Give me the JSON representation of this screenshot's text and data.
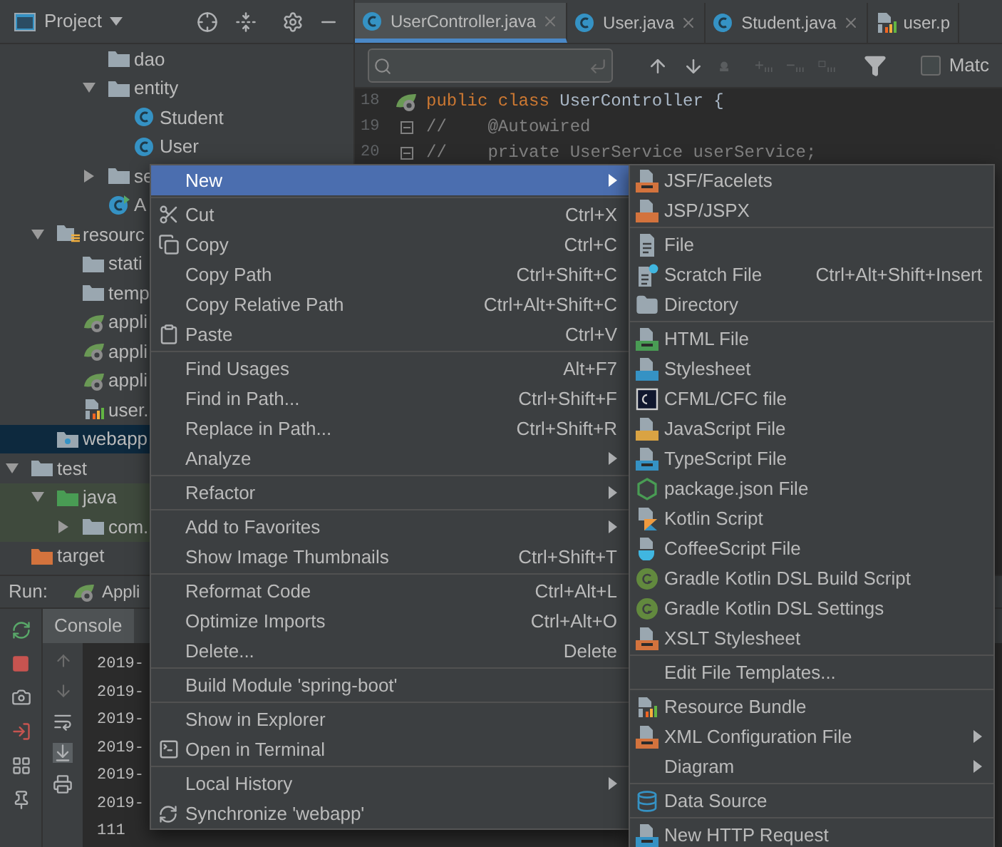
{
  "project_panel": {
    "title": "Project",
    "tree": [
      {
        "children": [
          {
            "children": [
              {
                "children": [
                  {
                    "label": "dao",
                    "kind": "folder",
                    "selected": false
                  },
                  {
                    "label": "entity",
                    "kind": "folder",
                    "expanded": true,
                    "selected": false,
                    "children": [
                      {
                        "label": "Student",
                        "kind": "class",
                        "selected": false
                      },
                      {
                        "label": "User",
                        "kind": "class",
                        "selected": false
                      }
                    ]
                  },
                  {
                    "label": "se",
                    "kind": "folder",
                    "expanded": false,
                    "selected": false
                  },
                  {
                    "label": "A",
                    "kind": "app-class",
                    "selected": false
                  }
                ]
              }
            ]
          },
          {
            "label": "resourc",
            "kind": "resources-folder",
            "expanded": true,
            "selected": false,
            "children": [
              {
                "label": "stati",
                "kind": "folder",
                "selected": false
              },
              {
                "label": "temp",
                "kind": "folder",
                "selected": false
              },
              {
                "label": "appli",
                "kind": "spring",
                "selected": false
              },
              {
                "label": "appli",
                "kind": "spring",
                "selected": false
              },
              {
                "label": "appli",
                "kind": "spring",
                "selected": false
              },
              {
                "label": "user.",
                "kind": "properties",
                "selected": false
              }
            ]
          },
          {
            "label": "webapp",
            "kind": "web-folder",
            "selected": true
          }
        ]
      },
      {
        "label": "test",
        "kind": "folder",
        "expanded": true,
        "selected": false,
        "children": [
          {
            "label": "java",
            "kind": "test-folder",
            "expanded": true,
            "selected": false,
            "children": [
              {
                "label": "com.",
                "kind": "folder",
                "expanded": false,
                "selected": false
              }
            ]
          }
        ]
      },
      {
        "label": "target",
        "kind": "excluded-folder",
        "selected": false
      }
    ]
  },
  "editor": {
    "tabs": [
      {
        "label": "UserController.java",
        "kind": "class",
        "selected": true
      },
      {
        "label": "User.java",
        "kind": "class",
        "selected": false
      },
      {
        "label": "Student.java",
        "kind": "class",
        "selected": false
      },
      {
        "label": "user.p",
        "kind": "properties",
        "selected": false
      }
    ],
    "match_case": {
      "label": "Matc",
      "checked": false
    },
    "lines": [
      {
        "number": "18",
        "segments": [
          {
            "text": "public class ",
            "kind": "keyword"
          },
          {
            "text": "UserController {",
            "kind": "plain"
          }
        ]
      },
      {
        "number": "19",
        "segments": [
          {
            "text": "//    @Autowired",
            "kind": "comment"
          }
        ]
      },
      {
        "number": "20",
        "segments": [
          {
            "text": "//    private UserService userService;",
            "kind": "comment"
          }
        ]
      }
    ]
  },
  "run_panel": {
    "label": "Run:",
    "config": "Appli",
    "tabs": [
      {
        "label": "Console",
        "selected": true
      }
    ],
    "output": [
      "2019-",
      "2019-",
      "2019-",
      "2019-",
      "2019-",
      "2019-",
      "111"
    ]
  },
  "context_menu": {
    "groups": [
      [
        {
          "label": "New",
          "has_submenu": true,
          "selected": true
        }
      ],
      [
        {
          "label": "Cut",
          "shortcut": "Ctrl+X",
          "selected": false
        },
        {
          "label": "Copy",
          "shortcut": "Ctrl+C",
          "selected": false
        },
        {
          "label": "Copy Path",
          "shortcut": "Ctrl+Shift+C",
          "selected": false
        },
        {
          "label": "Copy Relative Path",
          "shortcut": "Ctrl+Alt+Shift+C",
          "selected": false
        },
        {
          "label": "Paste",
          "shortcut": "Ctrl+V",
          "selected": false
        }
      ],
      [
        {
          "label": "Find Usages",
          "shortcut": "Alt+F7",
          "selected": false
        },
        {
          "label": "Find in Path...",
          "shortcut": "Ctrl+Shift+F",
          "selected": false
        },
        {
          "label": "Replace in Path...",
          "shortcut": "Ctrl+Shift+R",
          "selected": false
        },
        {
          "label": "Analyze",
          "has_submenu": true,
          "selected": false
        }
      ],
      [
        {
          "label": "Refactor",
          "has_submenu": true,
          "selected": false
        }
      ],
      [
        {
          "label": "Add to Favorites",
          "has_submenu": true,
          "selected": false
        },
        {
          "label": "Show Image Thumbnails",
          "shortcut": "Ctrl+Shift+T",
          "selected": false
        }
      ],
      [
        {
          "label": "Reformat Code",
          "shortcut": "Ctrl+Alt+L",
          "selected": false
        },
        {
          "label": "Optimize Imports",
          "shortcut": "Ctrl+Alt+O",
          "selected": false
        },
        {
          "label": "Delete...",
          "shortcut": "Delete",
          "selected": false
        }
      ],
      [
        {
          "label": "Build Module 'spring-boot'",
          "selected": false
        }
      ],
      [
        {
          "label": "Show in Explorer",
          "selected": false
        },
        {
          "label": "Open in Terminal",
          "selected": false
        }
      ],
      [
        {
          "label": "Local History",
          "has_submenu": true,
          "selected": false
        },
        {
          "label": "Synchronize 'webapp'",
          "selected": false
        }
      ]
    ]
  },
  "submenu": {
    "groups": [
      [
        {
          "label": "JSF/Facelets",
          "selected": false
        },
        {
          "label": "JSP/JSPX",
          "selected": false
        }
      ],
      [
        {
          "label": "File",
          "selected": false
        },
        {
          "label": "Scratch File",
          "shortcut": "Ctrl+Alt+Shift+Insert",
          "selected": false
        },
        {
          "label": "Directory",
          "selected": false
        }
      ],
      [
        {
          "label": "HTML File",
          "selected": false
        },
        {
          "label": "Stylesheet",
          "selected": false
        },
        {
          "label": "CFML/CFC file",
          "selected": false
        },
        {
          "label": "JavaScript File",
          "selected": false
        },
        {
          "label": "TypeScript File",
          "selected": false
        },
        {
          "label": "package.json File",
          "selected": false
        },
        {
          "label": "Kotlin Script",
          "selected": false
        },
        {
          "label": "CoffeeScript File",
          "selected": false
        },
        {
          "label": "Gradle Kotlin DSL Build Script",
          "selected": false
        },
        {
          "label": "Gradle Kotlin DSL Settings",
          "selected": false
        },
        {
          "label": "XSLT Stylesheet",
          "selected": false
        }
      ],
      [
        {
          "label": "Edit File Templates...",
          "selected": false
        }
      ],
      [
        {
          "label": "Resource Bundle",
          "selected": false
        },
        {
          "label": "XML Configuration File",
          "has_submenu": true,
          "selected": false
        },
        {
          "label": "Diagram",
          "has_submenu": true,
          "selected": false
        }
      ],
      [
        {
          "label": "Data Source",
          "selected": false
        }
      ],
      [
        {
          "label": "New HTTP Request",
          "selected": false
        }
      ]
    ]
  }
}
